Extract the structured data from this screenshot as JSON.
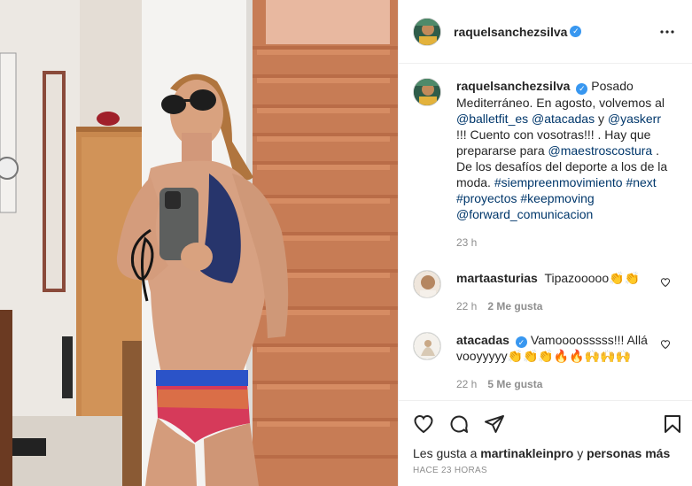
{
  "post": {
    "username": "raquelsanchezsilva",
    "verified_mark": "✓"
  },
  "caption": {
    "username": "raquelsanchezsilva",
    "text_1": "Posado Mediterráneo. En agosto, volvemos al",
    "mention_1": "@balletfit_es",
    "mention_2": "@atacadas",
    "text_2": "y",
    "mention_3": "@yaskerr",
    "text_3": "!!! Cuento con vosotras!!! . Hay que prepararse para",
    "mention_4": "@maestroscostura",
    "text_4": ". De los desafíos del deporte a los de la moda.",
    "hashtag_1": "#siempreenmovimiento",
    "hashtag_2": "#next",
    "hashtag_3": "#proyectos",
    "hashtag_4": "#keepmoving",
    "mention_5": "@forward_comunicacion",
    "time": "23 h"
  },
  "comments": [
    {
      "username": "martaasturias",
      "text": "Tipazooooo👏👏",
      "time": "22 h",
      "likes": "2 Me gusta"
    },
    {
      "username": "atacadas",
      "verified": true,
      "text": "Vamoooosssss!!! Allá vooyyyyy👏👏👏🔥🔥🙌🙌🙌",
      "time": "22 h",
      "likes": "5 Me gusta"
    }
  ],
  "likes_line": {
    "prefix": "Les gusta a",
    "user": "martinakleinpro",
    "middle": "y",
    "others": "personas más"
  },
  "timestamp": "HACE 23 HORAS",
  "icons": {
    "more": "more-options-icon",
    "like": "heart-icon",
    "comment": "comment-icon",
    "share": "paper-plane-icon",
    "save": "bookmark-icon"
  },
  "colors": {
    "link": "#00376b",
    "verified": "#3897f0",
    "meta": "#8e8e8e"
  }
}
